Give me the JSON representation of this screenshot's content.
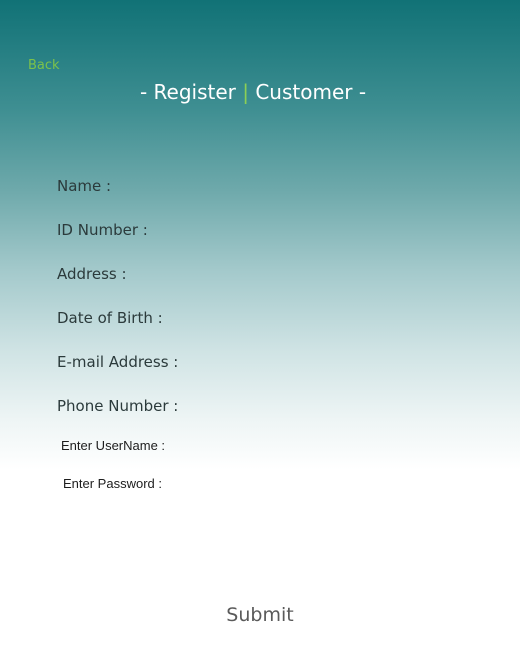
{
  "back_label": "Back",
  "title": {
    "prefix": "- Register ",
    "separator": "|",
    "suffix": " Customer -"
  },
  "fields": {
    "name": "Name :",
    "id_number": "ID Number :",
    "address": "Address :",
    "date_of_birth": "Date of Birth :",
    "email": "E-mail Address :",
    "phone": "Phone Number :",
    "username": "Enter UserName :",
    "password": "Enter Password :"
  },
  "submit_label": "Submit",
  "colors": {
    "header_teal": "#117276",
    "accent_green": "#7cc24a",
    "background_bottom": "#ffffff"
  }
}
